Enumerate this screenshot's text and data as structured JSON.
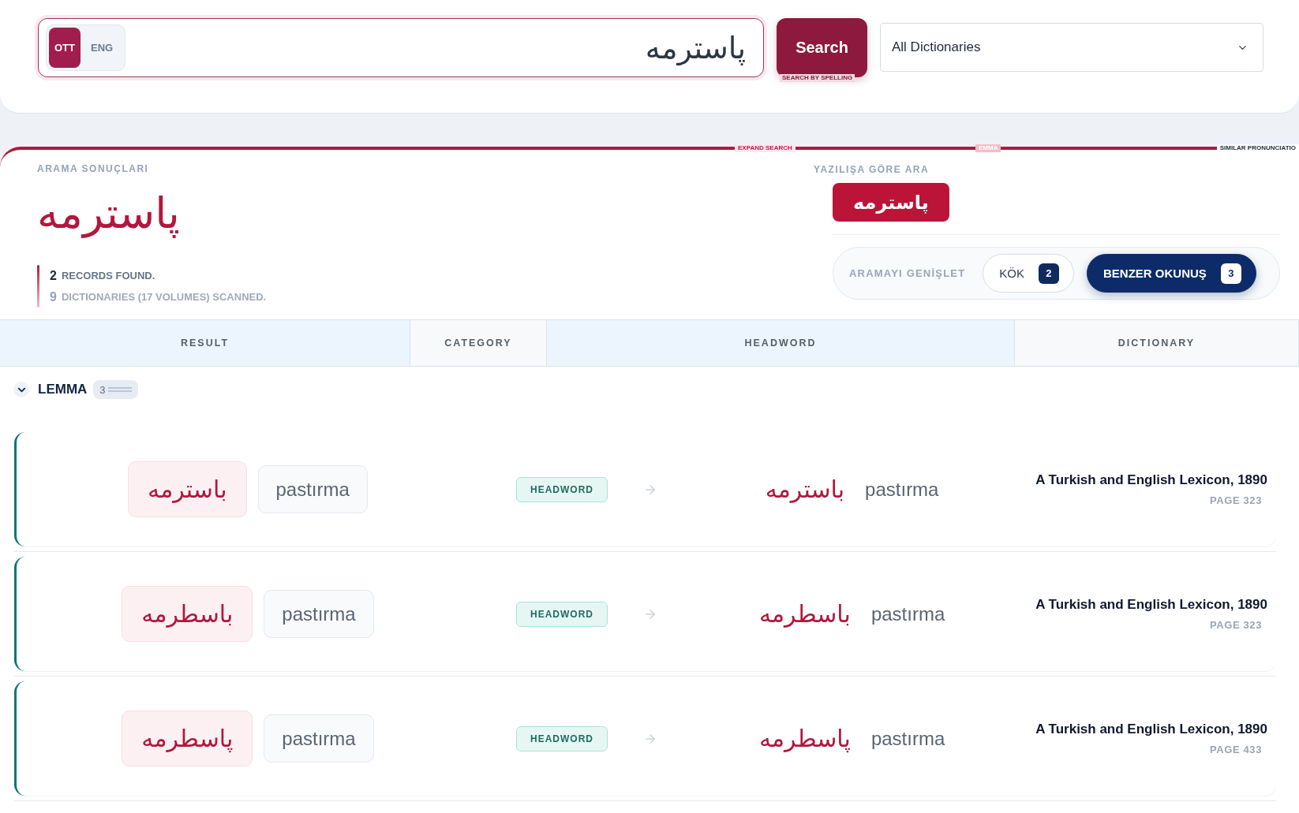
{
  "search": {
    "languages": [
      {
        "label": "OTT",
        "selected": true
      },
      {
        "label": "ENG",
        "selected": false
      }
    ],
    "value": "پاسترمه",
    "button": "Search",
    "button_hint": "SEARCH BY SPELLING",
    "dictionary_select": "All Dictionaries"
  },
  "section_tags": [
    "EXPAND SEARCH",
    "EMMA",
    "SIMILAR PRONUNCIATIO"
  ],
  "results": {
    "label": "ARAMA SONUÇLARI",
    "query": "پاسترمه",
    "stats": [
      {
        "count": "2",
        "text": "RECORDS FOUND."
      },
      {
        "count": "9",
        "text": "DICTIONARIES (17 VOLUMES) SCANNED."
      }
    ]
  },
  "spelling_search": {
    "label": "YAZILIŞA GÖRE ARA",
    "chips": [
      "پاسترمه"
    ]
  },
  "expand_search": {
    "label": "ARAMAYI GENİŞLET",
    "options": [
      {
        "label": "KÖK",
        "count": "2",
        "selected": false
      },
      {
        "label": "BENZER OKUNUŞ",
        "count": "3",
        "selected": true
      }
    ]
  },
  "table": {
    "columns": [
      "RESULT",
      "CATEGORY",
      "HEADWORD",
      "DICTIONARY"
    ],
    "groups": [
      {
        "title": "LEMMA",
        "count": "3",
        "expanded": true,
        "rows": [
          {
            "result_arabic": "باسترمه",
            "result_latin": "pastırma",
            "category": "HEADWORD",
            "headword_arabic": "باسترمه",
            "headword_latin": "pastırma",
            "dictionary": "A Turkish and English Lexicon, 1890",
            "page": "PAGE 323"
          },
          {
            "result_arabic": "باسطرمه",
            "result_latin": "pastırma",
            "category": "HEADWORD",
            "headword_arabic": "باسطرمه",
            "headword_latin": "pastırma",
            "dictionary": "A Turkish and English Lexicon, 1890",
            "page": "PAGE 323"
          },
          {
            "result_arabic": "پاسطرمه",
            "result_latin": "pastırma",
            "category": "HEADWORD",
            "headword_arabic": "پاسطرمه",
            "headword_latin": "pastırma",
            "dictionary": "A Turkish and English Lexicon, 1890",
            "page": "PAGE 433"
          }
        ]
      }
    ]
  }
}
